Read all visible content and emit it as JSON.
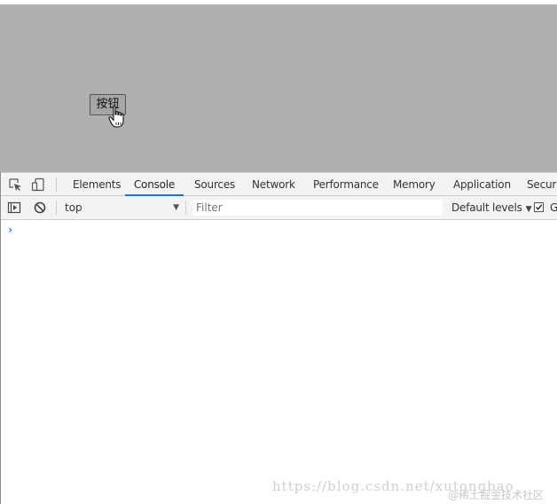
{
  "page": {
    "button_label": "按钮"
  },
  "devtools": {
    "tabs": [
      {
        "label": "Elements"
      },
      {
        "label": "Console",
        "active": true
      },
      {
        "label": "Sources"
      },
      {
        "label": "Network"
      },
      {
        "label": "Performance"
      },
      {
        "label": "Memory"
      },
      {
        "label": "Application"
      },
      {
        "label": "Securi"
      }
    ],
    "icons": {
      "inspect": "inspect-element-icon",
      "device": "device-toolbar-icon",
      "sidebar": "show-sidebar-icon",
      "clear": "clear-console-icon"
    },
    "console": {
      "context_value": "top",
      "filter_placeholder": "Filter",
      "levels_label": "Default levels",
      "checkbox_label": "G",
      "checkbox_checked": true,
      "prompt_symbol": "›"
    },
    "accent_color": "#1a73e8"
  },
  "watermark": {
    "url_text": "https://blog.csdn.net/xutongbao",
    "community_text": "@稀土掘金技术社区"
  }
}
